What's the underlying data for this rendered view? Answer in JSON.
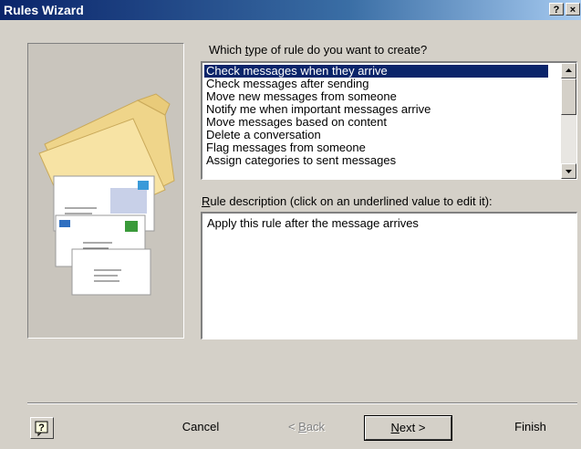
{
  "window": {
    "title": "Rules Wizard",
    "help_glyph": "?",
    "close_glyph": "×"
  },
  "rule_type": {
    "prompt_pre": "Which ",
    "prompt_key": "t",
    "prompt_post": "ype of rule do you want to create?",
    "items": [
      "Check messages when they arrive",
      "Check messages after sending",
      "Move new messages from someone",
      "Notify me when important messages arrive",
      "Move messages based on content",
      "Delete a conversation",
      "Flag messages from someone",
      "Assign categories to sent messages"
    ],
    "selected_index": 0
  },
  "description": {
    "label_key": "R",
    "label_rest": "ule description (click on an underlined value to edit it):",
    "text": "Apply this rule after the message arrives"
  },
  "buttons": {
    "cancel": "Cancel",
    "back_pre": "< ",
    "back_key": "B",
    "back_rest": "ack",
    "next_key": "N",
    "next_rest": "ext >",
    "finish": "Finish"
  },
  "icons": {
    "help": "help-icon",
    "up": "scroll-up-arrow-icon",
    "down": "scroll-down-arrow-icon",
    "illustration": "folder-envelopes-illustration"
  }
}
